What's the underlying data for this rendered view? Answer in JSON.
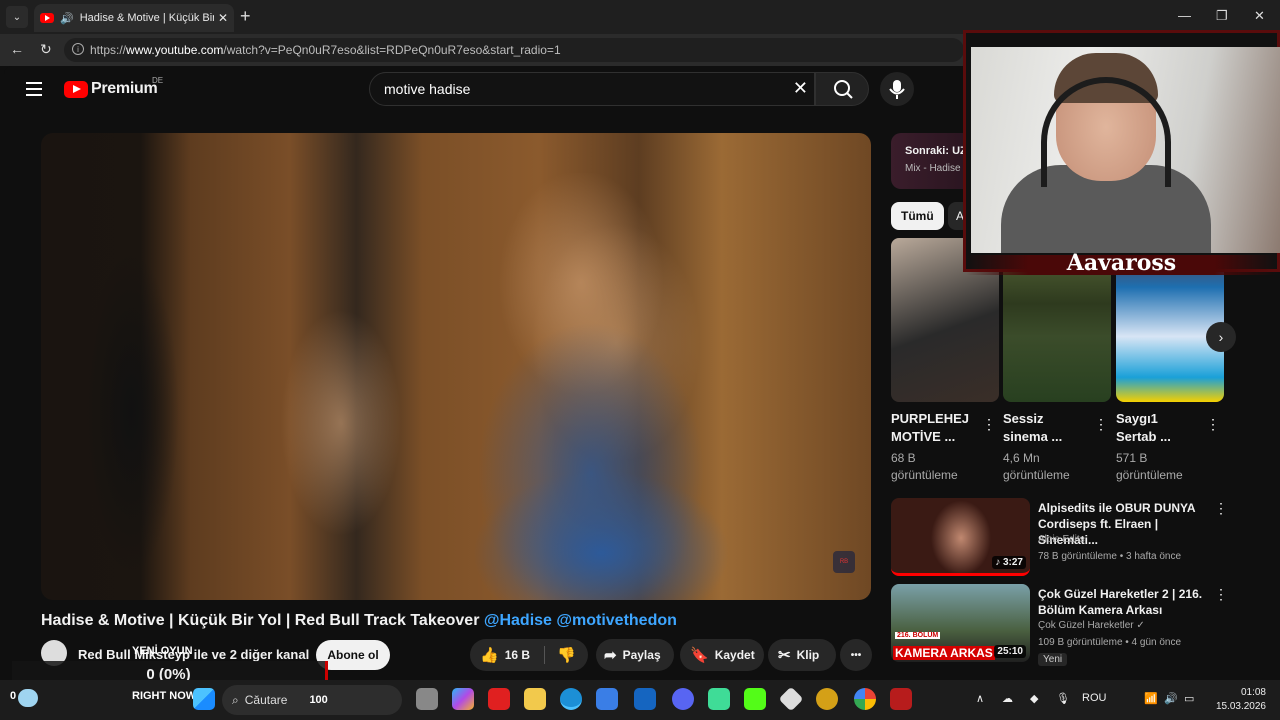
{
  "browser": {
    "tab_title": "Hadise & Motive | Küçük Bir Y",
    "url_domain": "www.youtube.com",
    "url_prefix": "https://",
    "url_path": "/watch?v=PeQn0uR7eso&list=RDPeQn0uR7eso&start_radio=1"
  },
  "youtube": {
    "logo_text": "Premium",
    "region": "DE",
    "search_value": "motive hadise",
    "video_title": "Hadise & Motive | Küçük Bir Yol | Red Bull Track Takeover",
    "mention_1": "@Hadise",
    "mention_2": "@motivethedon",
    "channel_name": "Red Bull Miksteyp ile ve 2 diğer kanal",
    "subscribe_label": "Abone ol",
    "likes": "16 B",
    "share_label": "Paylaş",
    "save_label": "Kaydet",
    "clip_label": "Klip",
    "more_label": "•••"
  },
  "sidebar": {
    "next_up": "Sonraki: UZ",
    "next_up_sub": "Mix - Hadise",
    "chip_all": "Tümü",
    "chip_2": "A",
    "shorts": [
      {
        "title": "PURPLEHEJ MOTİVE ...",
        "views": "68 B görüntüleme"
      },
      {
        "title": "Sessiz sinema ...",
        "views": "4,6 Mn görüntüleme"
      },
      {
        "title": "Saygı1 Sertab ...",
        "views": "571 B görüntüleme"
      }
    ],
    "recs": [
      {
        "title": "Alpisedits ile OBUR DUNYA Cordiseps ft. Elraen | Sinemati...",
        "channel": "Alpis Edits",
        "meta": "78 B görüntüleme • 3 hafta önce",
        "duration": "♪ 3:27"
      },
      {
        "title": "Çok Güzel Hareketler 2 | 216. Bölüm Kamera Arkası",
        "channel": "Çok Güzel Hareketler ✓",
        "meta": "109 B görüntüleme • 4 gün önce",
        "duration": "25:10",
        "badge": "Yeni",
        "thumb_text": "KAMERA ARKAS",
        "thumb_tag": "216. BÖLÜM"
      }
    ]
  },
  "overlay": {
    "streamer_name": "Aavaross",
    "progress_text": "0 (0%)",
    "new_game_label": "YENİ OYUN",
    "right_now_label": "RIGHT NOW",
    "count_label": "100",
    "left_count": "0"
  },
  "taskbar": {
    "search_placeholder": "Căutare",
    "lang": "ROU",
    "time": "01:08",
    "date": "15.03.2026"
  }
}
